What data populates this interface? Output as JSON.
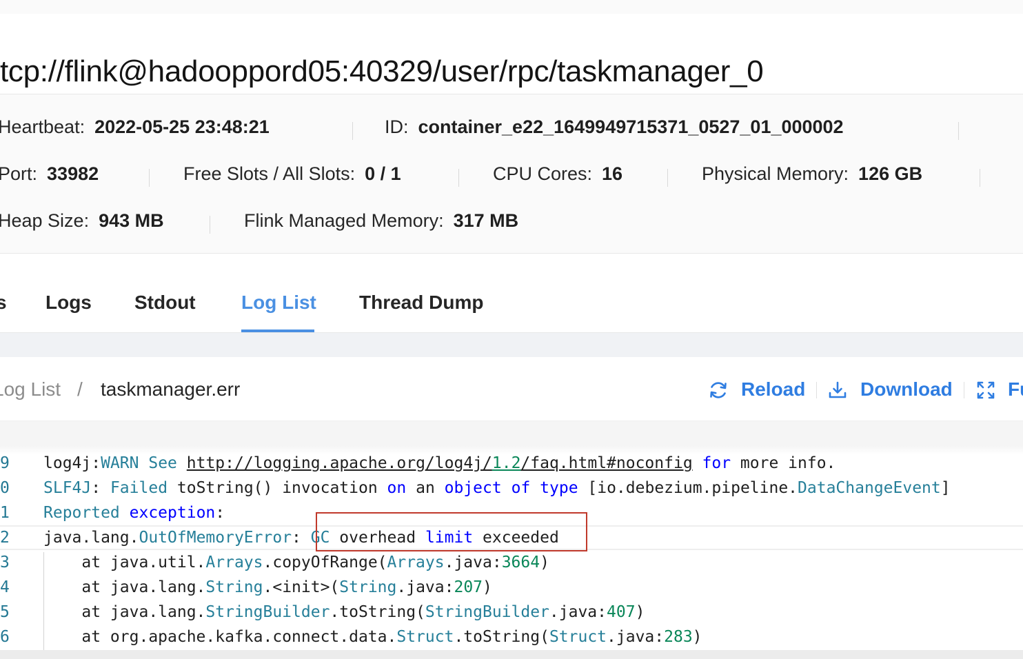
{
  "header": {
    "title": "tcp://flink@hadooppord05:40329/user/rpc/taskmanager_0"
  },
  "details": {
    "heartbeat": {
      "label": "Heartbeat:",
      "value": "2022-05-25 23:48:21"
    },
    "id": {
      "label": "ID:",
      "value": "container_e22_1649949715371_0527_01_000002"
    },
    "port": {
      "label": "Port:",
      "value": "33982"
    },
    "slots": {
      "label": "Free Slots / All Slots:",
      "value": "0 / 1"
    },
    "cpu": {
      "label": "CPU Cores:",
      "value": "16"
    },
    "memory": {
      "label": "Physical Memory:",
      "value": "126 GB"
    },
    "heap": {
      "label": "Heap Size:",
      "value": "943 MB"
    },
    "managed": {
      "label": "Flink Managed Memory:",
      "value": "317 MB"
    }
  },
  "tabs": {
    "partial": "s",
    "logs": "Logs",
    "stdout": "Stdout",
    "log_list": "Log List",
    "thread_dump": "Thread Dump",
    "active": "Log List"
  },
  "breadcrumb": {
    "parent": "Log List",
    "separator": "/",
    "current": "taskmanager.err"
  },
  "actions": {
    "reload": "Reload",
    "download": "Download",
    "fullscreen": "Fu"
  },
  "editor": {
    "colors": {
      "keyword": "#0000ff",
      "type": "#267f99",
      "number": "#098658",
      "line_number": "#237893",
      "highlight_box": "#c0392b",
      "accent": "#4a90e2"
    },
    "lines": [
      {
        "num": "9",
        "tokens": [
          {
            "t": "log4j",
            "c": "plain"
          },
          {
            "t": ":",
            "c": "plain"
          },
          {
            "t": "WARN",
            "c": "ty"
          },
          {
            "t": " ",
            "c": "plain"
          },
          {
            "t": "See",
            "c": "ty"
          },
          {
            "t": " ",
            "c": "plain"
          },
          {
            "t": "http://logging.apache.org/log4j/",
            "c": "lnk"
          },
          {
            "t": "1.2",
            "c": "lnk-nm"
          },
          {
            "t": "/faq.html#noconfig",
            "c": "lnk"
          },
          {
            "t": " ",
            "c": "plain"
          },
          {
            "t": "for",
            "c": "kw"
          },
          {
            "t": " more info.",
            "c": "plain"
          }
        ]
      },
      {
        "num": "0",
        "tokens": [
          {
            "t": "SLF4J",
            "c": "ty"
          },
          {
            "t": ": ",
            "c": "plain"
          },
          {
            "t": "Failed",
            "c": "ty"
          },
          {
            "t": " toString() invocation ",
            "c": "plain"
          },
          {
            "t": "on",
            "c": "kw"
          },
          {
            "t": " an ",
            "c": "plain"
          },
          {
            "t": "object",
            "c": "kw"
          },
          {
            "t": " ",
            "c": "plain"
          },
          {
            "t": "of",
            "c": "kw"
          },
          {
            "t": " ",
            "c": "plain"
          },
          {
            "t": "type",
            "c": "kw"
          },
          {
            "t": " [io.debezium.pipeline.",
            "c": "plain"
          },
          {
            "t": "DataChangeEvent",
            "c": "ty"
          },
          {
            "t": "]",
            "c": "plain"
          }
        ]
      },
      {
        "num": "1",
        "tokens": [
          {
            "t": "Reported",
            "c": "ty"
          },
          {
            "t": " ",
            "c": "plain"
          },
          {
            "t": "exception",
            "c": "kw"
          },
          {
            "t": ":",
            "c": "plain"
          }
        ]
      },
      {
        "num": "2",
        "current": true,
        "tokens": [
          {
            "t": "java.lang.",
            "c": "plain"
          },
          {
            "t": "OutOfMemoryError",
            "c": "ty"
          },
          {
            "t": ": ",
            "c": "plain"
          },
          {
            "t": "GC",
            "c": "ty"
          },
          {
            "t": " overhead ",
            "c": "plain"
          },
          {
            "t": "limit",
            "c": "kw"
          },
          {
            "t": " exceeded",
            "c": "plain"
          }
        ]
      },
      {
        "num": "3",
        "tokens": [
          {
            "t": "    at java.util.",
            "c": "plain"
          },
          {
            "t": "Arrays",
            "c": "ty"
          },
          {
            "t": ".copyOfRange(",
            "c": "plain"
          },
          {
            "t": "Arrays",
            "c": "ty"
          },
          {
            "t": ".java:",
            "c": "plain"
          },
          {
            "t": "3664",
            "c": "nm"
          },
          {
            "t": ")",
            "c": "plain"
          }
        ]
      },
      {
        "num": "4",
        "tokens": [
          {
            "t": "    at java.lang.",
            "c": "plain"
          },
          {
            "t": "String",
            "c": "ty"
          },
          {
            "t": ".<init>(",
            "c": "plain"
          },
          {
            "t": "String",
            "c": "ty"
          },
          {
            "t": ".java:",
            "c": "plain"
          },
          {
            "t": "207",
            "c": "nm"
          },
          {
            "t": ")",
            "c": "plain"
          }
        ]
      },
      {
        "num": "5",
        "tokens": [
          {
            "t": "    at java.lang.",
            "c": "plain"
          },
          {
            "t": "StringBuilder",
            "c": "ty"
          },
          {
            "t": ".toString(",
            "c": "plain"
          },
          {
            "t": "StringBuilder",
            "c": "ty"
          },
          {
            "t": ".java:",
            "c": "plain"
          },
          {
            "t": "407",
            "c": "nm"
          },
          {
            "t": ")",
            "c": "plain"
          }
        ]
      },
      {
        "num": "6",
        "tokens": [
          {
            "t": "    at org.apache.kafka.connect.data.",
            "c": "plain"
          },
          {
            "t": "Struct",
            "c": "ty"
          },
          {
            "t": ".toString(",
            "c": "plain"
          },
          {
            "t": "Struct",
            "c": "ty"
          },
          {
            "t": ".java:",
            "c": "plain"
          },
          {
            "t": "283",
            "c": "nm"
          },
          {
            "t": ")",
            "c": "plain"
          }
        ]
      }
    ]
  }
}
